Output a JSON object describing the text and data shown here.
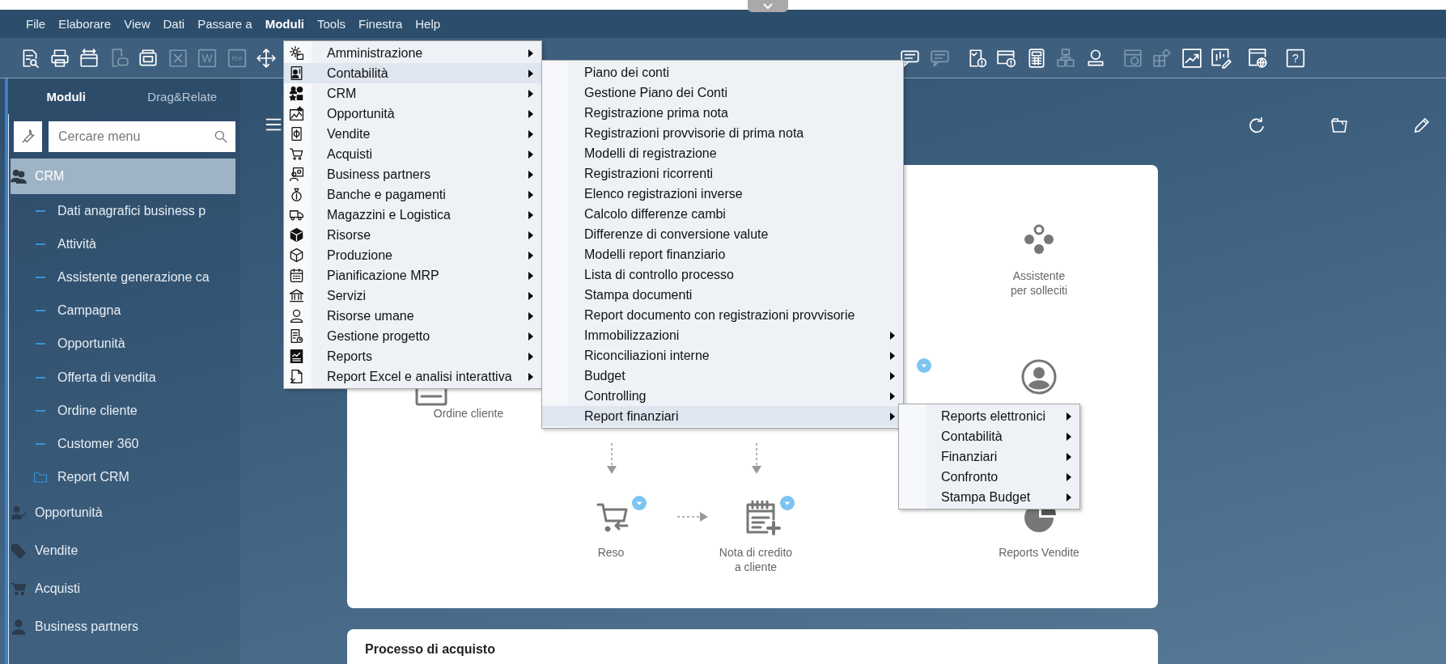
{
  "menu_bar": [
    {
      "label": "File",
      "selected": false
    },
    {
      "label": "Elaborare",
      "selected": false
    },
    {
      "label": "View",
      "selected": false
    },
    {
      "label": "Dati",
      "selected": false
    },
    {
      "label": "Passare a",
      "selected": false
    },
    {
      "label": "Moduli",
      "selected": true
    },
    {
      "label": "Tools",
      "selected": false
    },
    {
      "label": "Finestra",
      "selected": false
    },
    {
      "label": "Help",
      "selected": false
    }
  ],
  "toolbar": [
    [
      {
        "kind": "doc-search",
        "disabled": false
      },
      {
        "kind": "printer",
        "disabled": false
      },
      {
        "kind": "card-arrows",
        "disabled": false
      },
      {
        "kind": "doc-chat",
        "disabled": true
      },
      {
        "kind": "window-stack",
        "disabled": false
      },
      {
        "kind": "spreadsheet",
        "disabled": true
      },
      {
        "kind": "letter-box",
        "label": "W",
        "disabled": true
      },
      {
        "kind": "letter-box",
        "label": "PDF",
        "disabled": true
      },
      {
        "kind": "move",
        "disabled": false
      }
    ],
    [
      {
        "kind": "chat",
        "disabled": false
      },
      {
        "kind": "chat",
        "disabled": true
      }
    ],
    [
      {
        "kind": "checklist-alert",
        "disabled": false
      },
      {
        "kind": "card-alert",
        "disabled": false
      },
      {
        "kind": "calculator",
        "disabled": false
      },
      {
        "kind": "hierarchy",
        "disabled": true
      },
      {
        "kind": "person-stamp",
        "disabled": false
      }
    ],
    [
      {
        "kind": "dial",
        "disabled": true
      },
      {
        "kind": "puzzle",
        "disabled": true
      },
      {
        "kind": "chart-arrow",
        "disabled": false
      },
      {
        "kind": "chart-pen",
        "disabled": false
      }
    ],
    [
      {
        "kind": "browser-globe",
        "disabled": false
      }
    ],
    [
      {
        "kind": "letter-box",
        "label": "?",
        "disabled": false
      }
    ]
  ],
  "sidebar": {
    "tabs": [
      {
        "label": "Moduli",
        "selected": true
      },
      {
        "label": "Drag&Relate",
        "selected": false
      }
    ],
    "search": {
      "placeholder": "Cercare menu"
    },
    "items": [
      {
        "kind": "people",
        "label": "CRM",
        "selected": true,
        "children": [
          {
            "kind": "link",
            "label": "Dati anagrafici business p"
          },
          {
            "kind": "link",
            "label": "Attività"
          },
          {
            "kind": "link",
            "label": "Assistente generazione ca"
          },
          {
            "kind": "link",
            "label": "Campagna"
          },
          {
            "kind": "link",
            "label": "Opportunità"
          },
          {
            "kind": "link",
            "label": "Offerta di vendita"
          },
          {
            "kind": "link",
            "label": "Ordine cliente"
          },
          {
            "kind": "link",
            "label": "Customer 360"
          },
          {
            "kind": "folder",
            "label": "Report CRM"
          }
        ]
      },
      {
        "kind": "person-chart",
        "label": "Opportunità",
        "selected": false
      },
      {
        "kind": "tag",
        "label": "Vendite",
        "selected": false
      },
      {
        "kind": "cart",
        "label": "Acquisti",
        "selected": false
      },
      {
        "kind": "person",
        "label": "Business partners",
        "selected": false
      }
    ]
  },
  "modules_menu": {
    "items": [
      {
        "kind": "gear",
        "label": "Amministrazione",
        "submenu": true,
        "selected": false
      },
      {
        "kind": "id-card",
        "label": "Contabilità",
        "submenu": true,
        "selected": true
      },
      {
        "kind": "people",
        "label": "CRM",
        "submenu": true,
        "selected": false
      },
      {
        "kind": "chart",
        "label": "Opportunità",
        "submenu": true,
        "selected": false
      },
      {
        "kind": "bill",
        "label": "Vendite",
        "submenu": true,
        "selected": false
      },
      {
        "kind": "cart",
        "label": "Acquisti",
        "submenu": true,
        "selected": false
      },
      {
        "kind": "people-board",
        "label": "Business partners",
        "submenu": true,
        "selected": false
      },
      {
        "kind": "money-bag",
        "label": "Banche e pagamenti",
        "submenu": true,
        "selected": false
      },
      {
        "kind": "truck",
        "label": "Magazzini e Logistica",
        "submenu": true,
        "selected": false
      },
      {
        "kind": "cube",
        "label": "Risorse",
        "submenu": true,
        "selected": false
      },
      {
        "kind": "cube-outline",
        "label": "Produzione",
        "submenu": true,
        "selected": false
      },
      {
        "kind": "calendar",
        "label": "Pianificazione MRP",
        "submenu": true,
        "selected": false
      },
      {
        "kind": "bank",
        "label": "Servizi",
        "submenu": true,
        "selected": false
      },
      {
        "kind": "person",
        "label": "Risorse umane",
        "submenu": true,
        "selected": false
      },
      {
        "kind": "doc-clock",
        "label": "Gestione progetto",
        "submenu": true,
        "selected": false
      },
      {
        "kind": "report",
        "label": "Reports",
        "submenu": true,
        "selected": false
      },
      {
        "kind": "doc-cross",
        "label": "Report Excel e analisi interattiva",
        "submenu": true,
        "selected": false
      }
    ]
  },
  "accounting_menu": {
    "items": [
      {
        "label": "Piano dei conti",
        "submenu": false,
        "selected": false
      },
      {
        "label": "Gestione Piano dei Conti",
        "submenu": false,
        "selected": false
      },
      {
        "label": "Registrazione prima nota",
        "submenu": false,
        "selected": false
      },
      {
        "label": "Registrazioni provvisorie di prima nota",
        "submenu": false,
        "selected": false
      },
      {
        "label": "Modelli di registrazione",
        "submenu": false,
        "selected": false
      },
      {
        "label": "Registrazioni ricorrenti",
        "submenu": false,
        "selected": false
      },
      {
        "label": "Elenco registrazioni inverse",
        "submenu": false,
        "selected": false
      },
      {
        "label": "Calcolo differenze cambi",
        "submenu": false,
        "selected": false
      },
      {
        "label": "Differenze di conversione valute",
        "submenu": false,
        "selected": false
      },
      {
        "label": "Modelli report finanziario",
        "submenu": false,
        "selected": false
      },
      {
        "label": "Lista di controllo processo",
        "submenu": false,
        "selected": false
      },
      {
        "label": "Stampa documenti",
        "submenu": false,
        "selected": false
      },
      {
        "label": "Report documento con registrazioni provvisorie",
        "submenu": false,
        "selected": false
      },
      {
        "label": "Immobilizzazioni",
        "submenu": true,
        "selected": false
      },
      {
        "label": "Riconciliazioni interne",
        "submenu": true,
        "selected": false
      },
      {
        "label": "Budget",
        "submenu": true,
        "selected": false
      },
      {
        "label": "Controlling",
        "submenu": true,
        "selected": false
      },
      {
        "label": "Report finanziari",
        "submenu": true,
        "selected": true
      }
    ]
  },
  "financial_reports_menu": {
    "items": [
      {
        "label": "Reports elettronici",
        "submenu": true,
        "selected": false
      },
      {
        "label": "Contabilità",
        "submenu": true,
        "selected": false
      },
      {
        "label": "Finanziari",
        "submenu": true,
        "selected": false
      },
      {
        "label": "Confronto",
        "submenu": true,
        "selected": false
      },
      {
        "label": "Stampa Budget",
        "submenu": true,
        "selected": false
      }
    ]
  },
  "sales_process_card": {
    "nodes": [
      {
        "kind": "form",
        "label": "Ordine cliente",
        "menu": false
      },
      {
        "kind": "dots",
        "label": "Assistente\nper solleciti",
        "menu": false
      },
      {
        "kind": "person-circle",
        "menu": false
      },
      {
        "kind": "cart-return",
        "label": "Reso",
        "menu": true
      },
      {
        "kind": "calendar-plus",
        "label": "Nota di credito\na cliente",
        "menu": true
      },
      {
        "kind": "pie",
        "label": "Reports Vendite",
        "menu": false
      }
    ]
  },
  "purchase_process_card": {
    "title": "Processo di acquisto"
  }
}
